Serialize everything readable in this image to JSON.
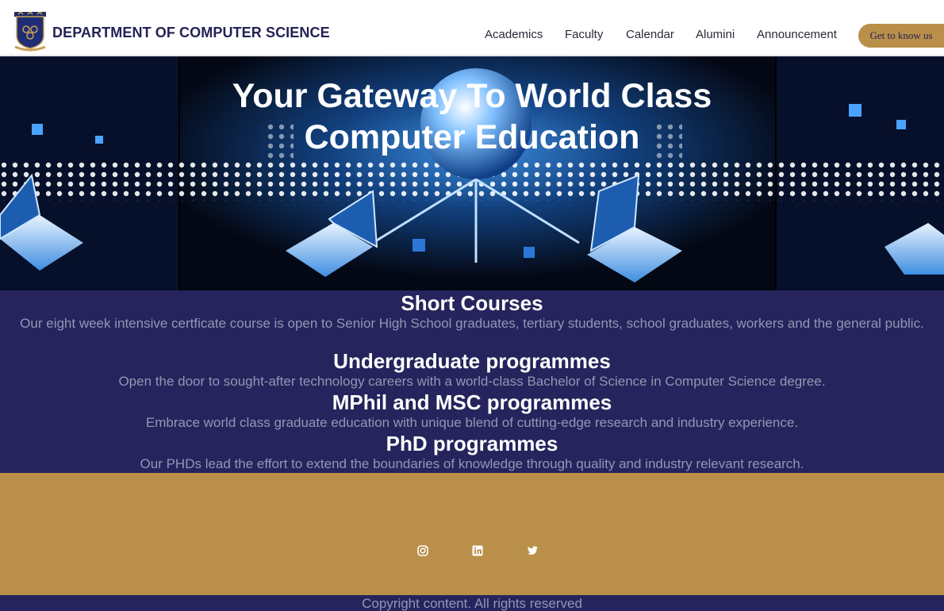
{
  "navbar": {
    "brand": "DEPARTMENT OF COMPUTER SCIENCE",
    "links": [
      "Academics",
      "Faculty",
      "Calendar",
      "Alumini",
      "Announcement"
    ],
    "cta": "Get to know us"
  },
  "hero": {
    "title_line1": "Your Gateway To World Class",
    "title_line2": "Computer Education"
  },
  "programmes": [
    {
      "title": "Short Courses",
      "description": "Our eight week intensive certficate course is open to Senior High School graduates, tertiary students, school graduates, workers and the general public."
    },
    {
      "title": "Undergraduate programmes",
      "description": "Open the door to sought-after technology careers with a world-class Bachelor of Science in Computer Science degree."
    },
    {
      "title": "MPhil and MSC programmes",
      "description": "Embrace world class graduate education with unique blend of cutting-edge research and industry experience."
    },
    {
      "title": "PhD programmes",
      "description": "Our PHDs lead the effort to extend the boundaries of knowledge through quality and industry relevant research."
    }
  ],
  "footer": {
    "social_icons": [
      "instagram-icon",
      "linkedin-icon",
      "twitter-icon"
    ],
    "copyright": "Copyright content. All rights reserved"
  },
  "colors": {
    "navy": "#25245c",
    "gold": "#b98f49",
    "muted_text": "#9595b5"
  }
}
